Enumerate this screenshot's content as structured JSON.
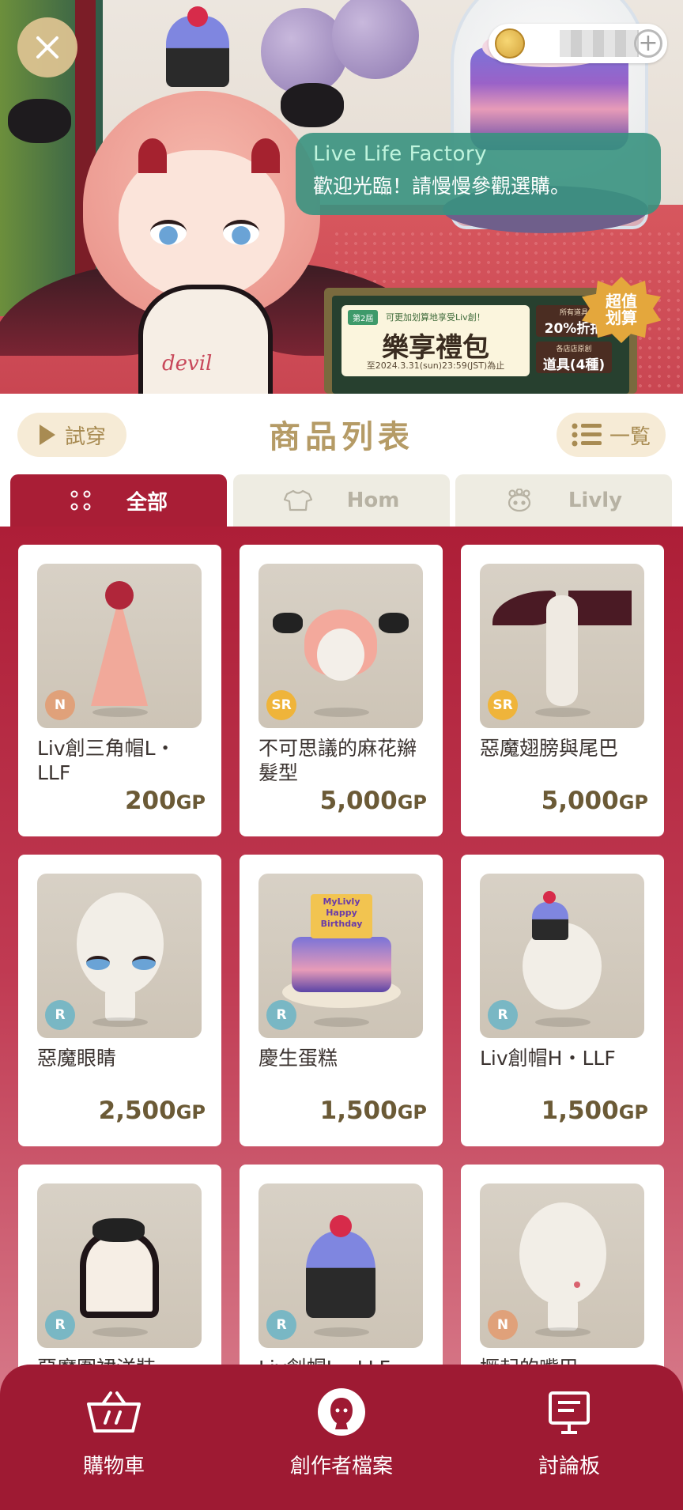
{
  "hero": {
    "speech_speaker": "Live Life Factory",
    "speech_message": "歡迎光臨！請慢慢參觀選購。",
    "dress_text": "devil",
    "banner": {
      "tag": "第2屆",
      "subtitle": "可更加划算地享受Liv創！",
      "title": "樂享禮包",
      "date": "至2024.3.31(sun)23:59(JST)為止",
      "side_top_small": "所有道具",
      "side_top_big": "20%折扣",
      "side_bottom_small": "各店店原創",
      "side_bottom_big": "道具(4種)"
    },
    "starburst": "超值\n划算"
  },
  "header": {
    "try_on_label": "試穿",
    "title": "商品列表",
    "list_label": "一覧"
  },
  "tabs": [
    {
      "label": "全部",
      "icon": "four-dots-icon",
      "active": true
    },
    {
      "label": "Hom",
      "icon": "shirt-icon",
      "active": false
    },
    {
      "label": "Livly",
      "icon": "livly-face-icon",
      "active": false
    }
  ],
  "items": [
    {
      "name": "Liv創三角帽L・LLF",
      "rarity": "N",
      "price": "200",
      "unit": "GP"
    },
    {
      "name": "不可思議的麻花辮髮型",
      "rarity": "SR",
      "price": "5,000",
      "unit": "GP"
    },
    {
      "name": "惡魔翅膀與尾巴",
      "rarity": "SR",
      "price": "5,000",
      "unit": "GP"
    },
    {
      "name": "惡魔眼睛",
      "rarity": "R",
      "price": "2,500",
      "unit": "GP"
    },
    {
      "name": "慶生蛋糕",
      "rarity": "R",
      "price": "1,500",
      "unit": "GP"
    },
    {
      "name": "Liv創帽H・LLF",
      "rarity": "R",
      "price": "1,500",
      "unit": "GP"
    },
    {
      "name": "惡魔圍裙洋裝",
      "rarity": "R",
      "price": "",
      "unit": ""
    },
    {
      "name": "Liv創帽L・LLF",
      "rarity": "R",
      "price": "",
      "unit": ""
    },
    {
      "name": "撅起的嘴巴",
      "rarity": "N",
      "price": "",
      "unit": ""
    }
  ],
  "rarity_colors": {
    "N": "#e0a17a",
    "SR": "#efb43a",
    "R": "#79b7c4"
  },
  "cake_art": {
    "line1": "MyLivly",
    "line2": "Happy",
    "line3": "Birthday"
  },
  "nav": {
    "cart_label": "購物車",
    "creator_label": "創作者檔案",
    "board_label": "討論板"
  },
  "colors": {
    "primary": "#a91e36",
    "accent_gold": "#b59b66",
    "speech_bg": "#389280"
  }
}
